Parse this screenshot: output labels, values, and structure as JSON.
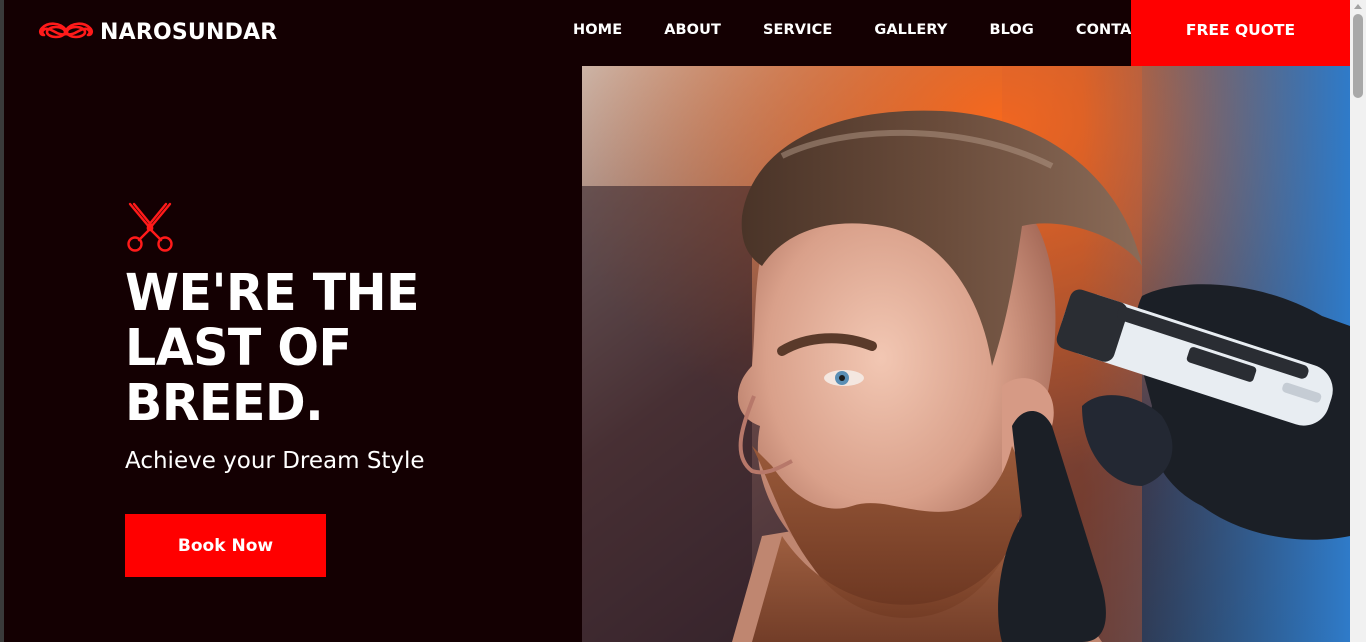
{
  "brand": {
    "name": "NAROSUNDAR",
    "logo_icon": "mustache-icon",
    "accent_color": "#ff0000",
    "background_color": "#140002"
  },
  "nav": {
    "items": [
      {
        "label": "HOME"
      },
      {
        "label": "ABOUT"
      },
      {
        "label": "SERVICE"
      },
      {
        "label": "GALLERY"
      },
      {
        "label": "BLOG"
      },
      {
        "label": "CONTACT"
      }
    ],
    "cta_label": "FREE QUOTE"
  },
  "hero": {
    "icon": "scissors-icon",
    "title_lines": [
      "WE'RE THE",
      "LAST OF",
      "BREED."
    ],
    "subtitle": "Achieve your Dream Style",
    "button_label": "Book Now",
    "image_subject": "barber-haircut-photo"
  }
}
